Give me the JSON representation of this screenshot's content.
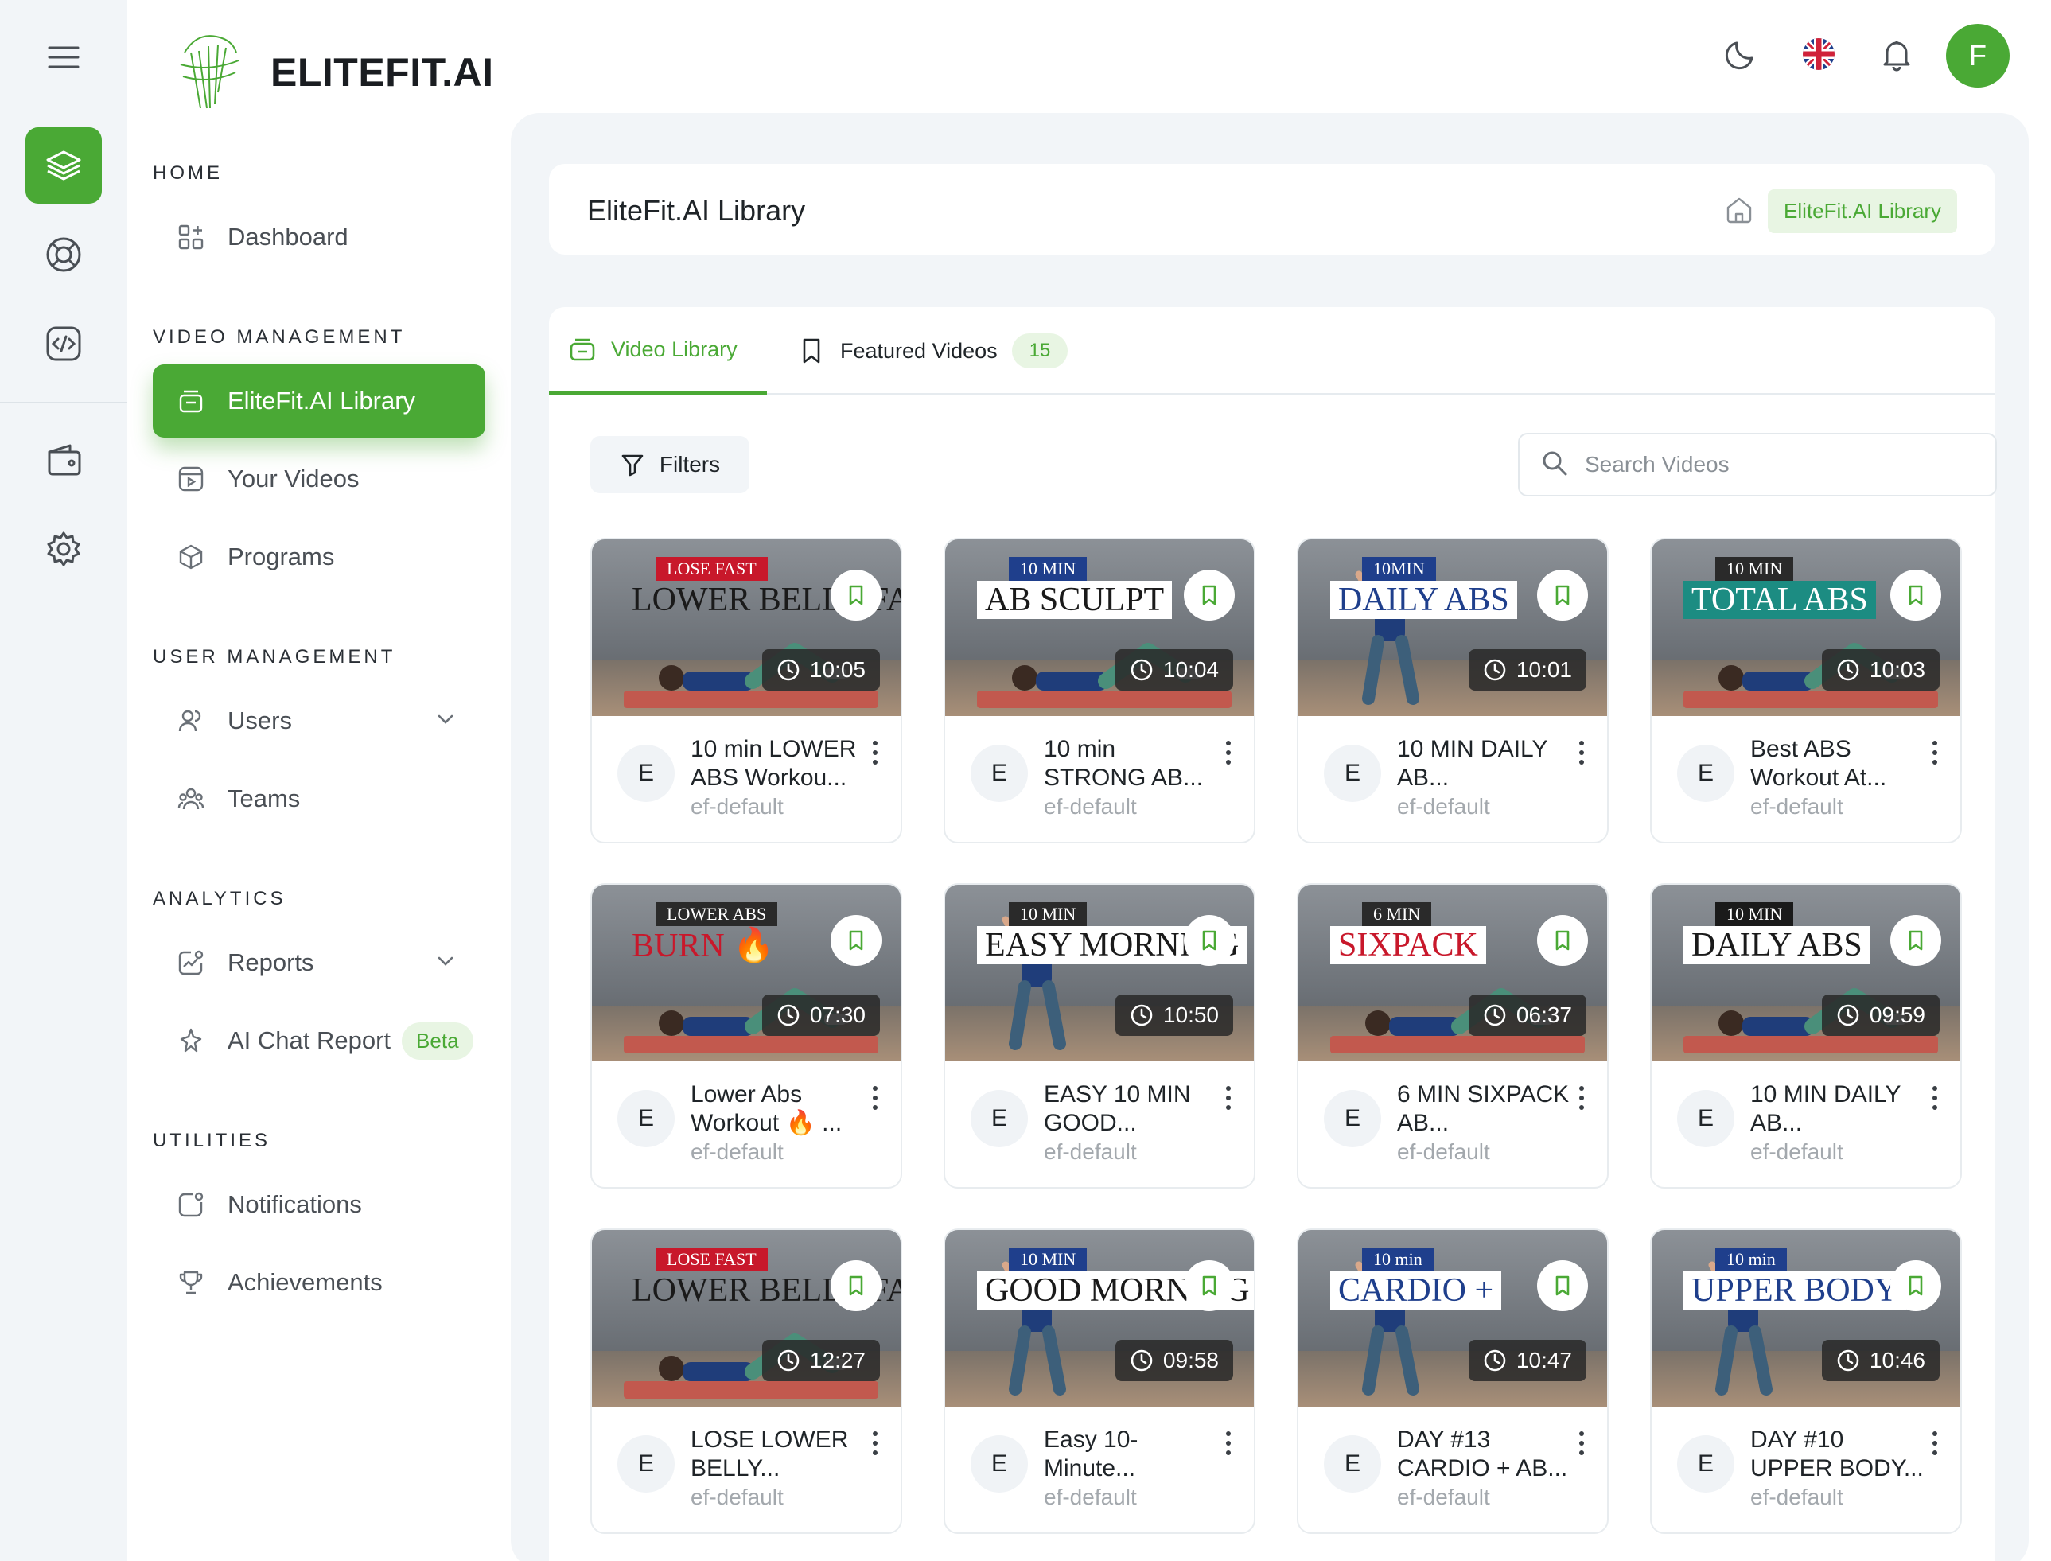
{
  "brand": {
    "name": "ELITEFIT.AI"
  },
  "colors": {
    "accent": "#4aa935",
    "accent_soft": "#e8f5e3",
    "panel": "#f2f5f8"
  },
  "rail": {
    "icons": [
      "menu-icon",
      "layers-icon",
      "lifebuoy-icon",
      "code-icon",
      "wallet-icon",
      "gear-icon"
    ]
  },
  "sidebar": {
    "sections": [
      {
        "title": "HOME",
        "items": [
          {
            "label": "Dashboard",
            "icon": "dashboard-icon"
          }
        ]
      },
      {
        "title": "VIDEO MANAGEMENT",
        "items": [
          {
            "label": "EliteFit.AI Library",
            "icon": "library-icon",
            "active": true
          },
          {
            "label": "Your Videos",
            "icon": "video-icon"
          },
          {
            "label": "Programs",
            "icon": "cube-icon"
          }
        ]
      },
      {
        "title": "USER MANAGEMENT",
        "items": [
          {
            "label": "Users",
            "icon": "users-icon",
            "expandable": true
          },
          {
            "label": "Teams",
            "icon": "teams-icon"
          }
        ]
      },
      {
        "title": "ANALYTICS",
        "items": [
          {
            "label": "Reports",
            "icon": "reports-icon",
            "expandable": true
          },
          {
            "label": "AI Chat Report",
            "icon": "sparkle-icon",
            "badge": "Beta"
          }
        ]
      },
      {
        "title": "UTILITIES",
        "items": [
          {
            "label": "Notifications",
            "icon": "notification-icon"
          },
          {
            "label": "Achievements",
            "icon": "trophy-icon"
          }
        ]
      }
    ]
  },
  "topbar": {
    "icons": [
      "moon-icon",
      "uk-flag-icon",
      "bell-icon"
    ],
    "avatar_initial": "F"
  },
  "header": {
    "title": "EliteFit.AI Library",
    "breadcrumb": "EliteFit.AI Library"
  },
  "tabs": [
    {
      "label": "Video Library",
      "active": true
    },
    {
      "label": "Featured Videos",
      "count": "15"
    }
  ],
  "toolbar": {
    "filters_label": "Filters",
    "search_placeholder": "Search Videos"
  },
  "videos": [
    {
      "title": "10 min LOWER ABS Workou...",
      "channel": "ef-default",
      "avatar": "E",
      "duration": "10:05",
      "overlay_small": "LOSE FAST",
      "overlay_big": "LOWER BELLY FA"
    },
    {
      "title": "10 min STRONG AB...",
      "channel": "ef-default",
      "avatar": "E",
      "duration": "10:04",
      "overlay_small": "10 MIN",
      "overlay_big": "AB SCULPT"
    },
    {
      "title": "10 MIN DAILY AB...",
      "channel": "ef-default",
      "avatar": "E",
      "duration": "10:01",
      "overlay_small": "10MIN",
      "overlay_big": "DAILY ABS"
    },
    {
      "title": "Best ABS Workout At...",
      "channel": "ef-default",
      "avatar": "E",
      "duration": "10:03",
      "overlay_small": "10 MIN",
      "overlay_big": "TOTAL ABS"
    },
    {
      "title": "Lower Abs Workout 🔥 ...",
      "channel": "ef-default",
      "avatar": "E",
      "duration": "07:30",
      "overlay_small": "LOWER ABS",
      "overlay_big": "BURN 🔥"
    },
    {
      "title": "EASY 10 MIN GOOD...",
      "channel": "ef-default",
      "avatar": "E",
      "duration": "10:50",
      "overlay_small": "10 MIN",
      "overlay_big": "EASY MORNING"
    },
    {
      "title": "6 MIN SIXPACK AB...",
      "channel": "ef-default",
      "avatar": "E",
      "duration": "06:37",
      "overlay_small": "6 MIN",
      "overlay_big": "SIXPACK"
    },
    {
      "title": "10 MIN DAILY AB...",
      "channel": "ef-default",
      "avatar": "E",
      "duration": "09:59",
      "overlay_small": "10 MIN",
      "overlay_big": "DAILY ABS"
    },
    {
      "title": "LOSE LOWER BELLY...",
      "channel": "ef-default",
      "avatar": "E",
      "duration": "12:27",
      "overlay_small": "LOSE FAST",
      "overlay_big": "LOWER BELLY FA"
    },
    {
      "title": "Easy 10-Minute...",
      "channel": "ef-default",
      "avatar": "E",
      "duration": "09:58",
      "overlay_small": "10 MIN",
      "overlay_big": "GOOD MORNING"
    },
    {
      "title": "DAY #13 CARDIO + AB...",
      "channel": "ef-default",
      "avatar": "E",
      "duration": "10:47",
      "overlay_small": "10 min",
      "overlay_big": "CARDIO +"
    },
    {
      "title": "DAY #10 UPPER BODY...",
      "channel": "ef-default",
      "avatar": "E",
      "duration": "10:46",
      "overlay_small": "10 min",
      "overlay_big": "UPPER BODY"
    }
  ]
}
